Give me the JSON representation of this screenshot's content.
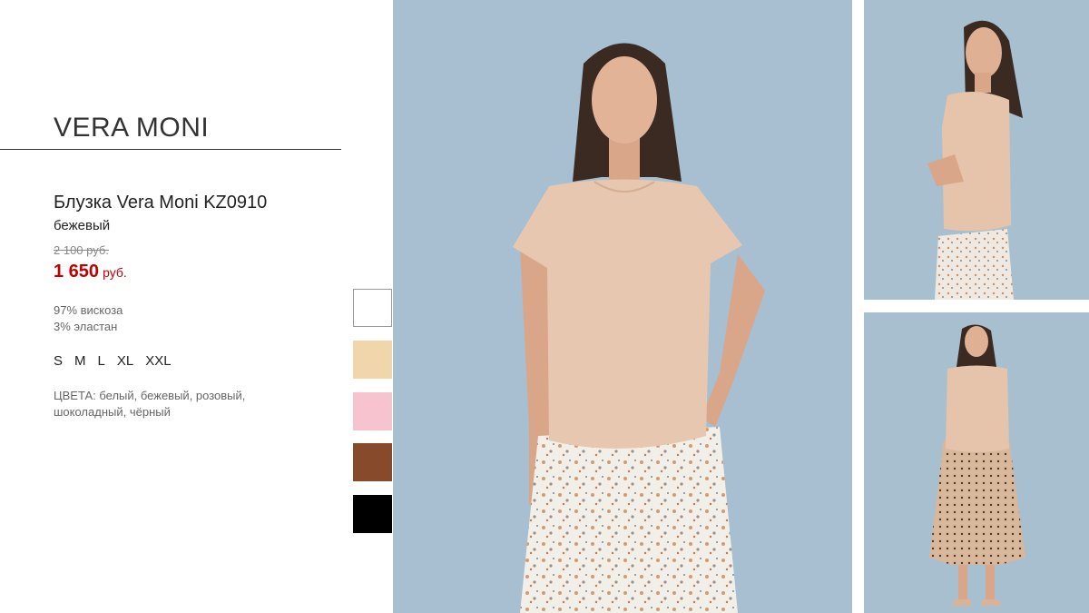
{
  "brand": "VERA MONI",
  "product": {
    "title": "Блузка Vera Moni KZ0910",
    "color": "бежевый",
    "old_price": "2 100 руб.",
    "new_price": "1 650",
    "currency": "руб.",
    "composition": [
      "97% вискоза",
      "3% эластан"
    ],
    "sizes": [
      "S",
      "M",
      "L",
      "XL",
      "XXL"
    ],
    "colors_text": "ЦВЕТА: белый, бежевый, розовый, шоколадный, чёрный"
  },
  "swatches": [
    {
      "name": "white",
      "hex": "#ffffff"
    },
    {
      "name": "beige",
      "hex": "#f1d6ab"
    },
    {
      "name": "pink",
      "hex": "#f6c3cf"
    },
    {
      "name": "chocolate",
      "hex": "#874a2b"
    },
    {
      "name": "black",
      "hex": "#000000"
    }
  ],
  "colors": {
    "accent_price": "#c00000",
    "background_photo": "#a7bfd0"
  }
}
